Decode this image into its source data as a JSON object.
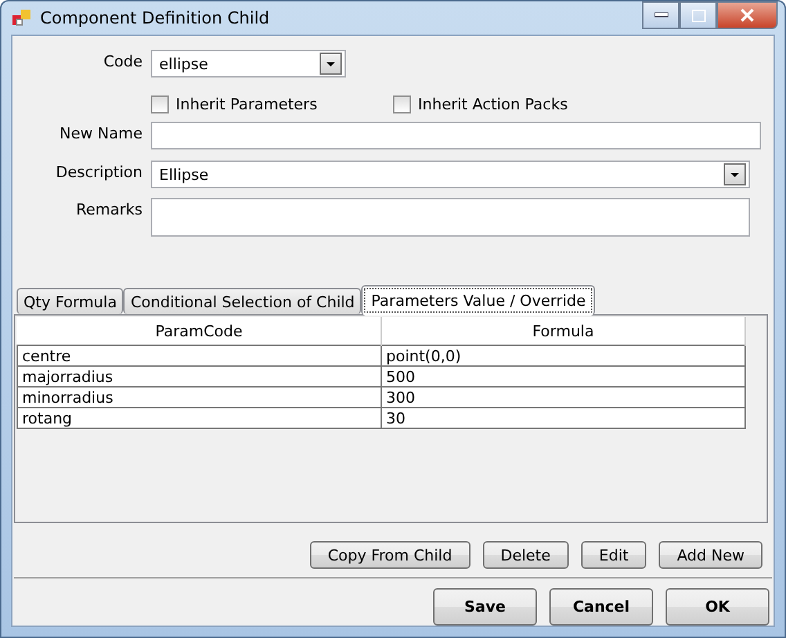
{
  "window": {
    "title": "Component Definition Child"
  },
  "code": {
    "label": "Code",
    "value": "ellipse"
  },
  "checkboxes": [
    {
      "label": "Inherit Parameters",
      "checked": false
    },
    {
      "label": "Inherit Action Packs",
      "checked": false
    }
  ],
  "new_name": {
    "label": "New Name"
  },
  "description": {
    "label": "Description",
    "value": "Ellipse"
  },
  "remarks": {
    "label": "Remarks"
  },
  "tabs": [
    {
      "label": "Qty Formula",
      "selected": false
    },
    {
      "label": "Conditional Selection of Child",
      "selected": false
    },
    {
      "label": "Parameters Value / Override",
      "selected": true
    }
  ],
  "table": {
    "columns": [
      "ParamCode",
      "Formula"
    ],
    "rows": [
      [
        "centre",
        "point(0,0)"
      ],
      [
        "majorradius",
        "500"
      ],
      [
        "minorradius",
        "300"
      ],
      [
        "rotang",
        "30"
      ]
    ]
  },
  "grid_buttons": [
    "Copy From Child",
    "Delete",
    "Edit",
    "Add New"
  ],
  "dialog_buttons": [
    "Save",
    "Cancel",
    "OK"
  ]
}
